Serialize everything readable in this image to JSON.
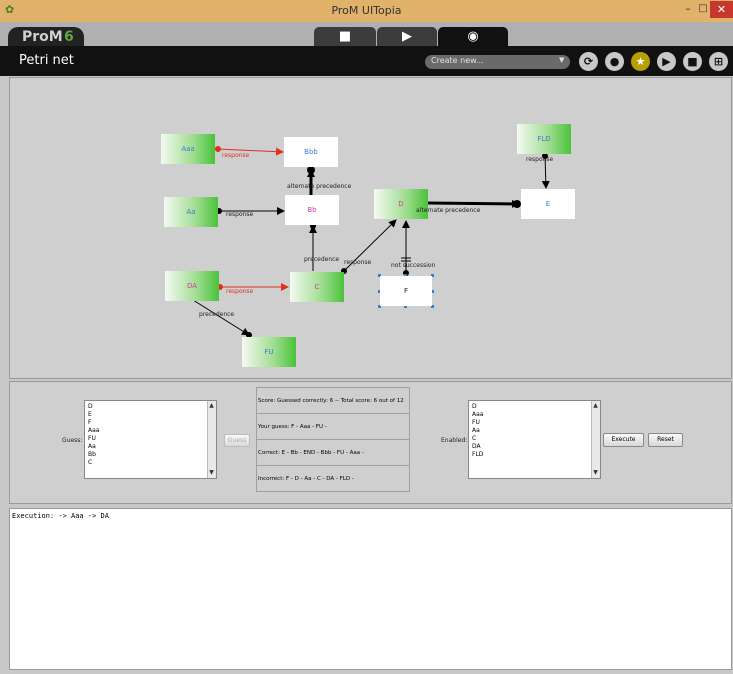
{
  "window": {
    "title": "ProM UITopia"
  },
  "prom": {
    "logo_text": "ProM",
    "version": "6"
  },
  "view_bar": {
    "title": "Petri net",
    "create_placeholder": "Create new..."
  },
  "icons": {
    "accent": "#b8a000",
    "names": [
      "refresh-icon",
      "drop-icon",
      "star-icon",
      "play-icon",
      "copy-icon",
      "grid-icon"
    ]
  },
  "model": {
    "nodes": [
      {
        "label": "Aaa"
      },
      {
        "label": "Bbb"
      },
      {
        "label": "FLD"
      },
      {
        "label": "Aa"
      },
      {
        "label": "Bb"
      },
      {
        "label": "D"
      },
      {
        "label": "E"
      },
      {
        "label": "DA"
      },
      {
        "label": "C"
      },
      {
        "label": "F"
      },
      {
        "label": "FU"
      }
    ],
    "edge_labels": [
      "response",
      "alternate precedence",
      "response",
      "response",
      "alternate precedence",
      "precedence",
      "response",
      "not succession",
      "response",
      "precedence"
    ],
    "colors": {
      "response_red": "#e03020",
      "label_blue": "#3a7ad8",
      "label_pink": "#d040a0"
    }
  },
  "game": {
    "guess_label": "Guess:",
    "guess_options": [
      "D",
      "E",
      "F",
      "Aaa",
      "FU",
      "Aa",
      "Bb",
      "C"
    ],
    "guess_button": "Guess",
    "score": "Score: Guessed correctly: 6 -- Total score: 6 out of 12",
    "your_guess": "Your guess: F - Aaa - FU -",
    "correct": "Correct: E - Bb - END - Bbb - FU - Aaa -",
    "incorrect": "Incorrect: F - D - Aa - C - DA - FLD -",
    "enabled_label": "Enabled:",
    "enabled_options": [
      "D",
      "Aaa",
      "FU",
      "Aa",
      "C",
      "DA",
      "FLD"
    ],
    "execute_button": "Execute",
    "reset_button": "Reset"
  },
  "execution": {
    "text": "Execution:  -> Aaa -> DA"
  }
}
